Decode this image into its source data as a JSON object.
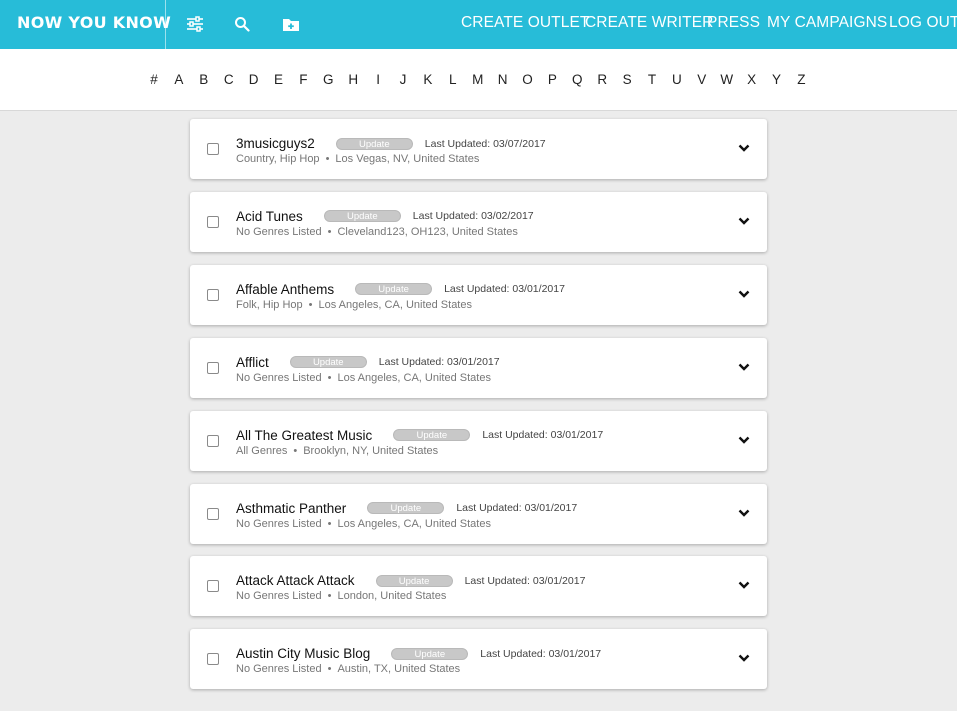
{
  "header": {
    "brand": "NOW YOU KNOW",
    "icons": [
      "sliders-icon",
      "search-icon",
      "folder-plus-icon"
    ],
    "nav": [
      "CREATE OUTLET",
      "CREATE WRITER",
      "PRESS",
      "MY CAMPAIGNS",
      "LOG OUT"
    ],
    "accent_color": "#27bcd8"
  },
  "alphabet": [
    "#",
    "A",
    "B",
    "C",
    "D",
    "E",
    "F",
    "G",
    "H",
    "I",
    "J",
    "K",
    "L",
    "M",
    "N",
    "O",
    "P",
    "Q",
    "R",
    "S",
    "T",
    "U",
    "V",
    "W",
    "X",
    "Y",
    "Z"
  ],
  "outlets": [
    {
      "name": "3musicguys2",
      "badge": "Update",
      "updated": "Last Updated: 03/07/2017",
      "genres": "Country, Hip Hop",
      "location": "Los Vegas, NV, United States"
    },
    {
      "name": "Acid Tunes",
      "badge": "Update",
      "updated": "Last Updated: 03/02/2017",
      "genres": "No Genres Listed",
      "location": "Cleveland123, OH123, United States"
    },
    {
      "name": "Affable Anthems",
      "badge": "Update",
      "updated": "Last Updated: 03/01/2017",
      "genres": "Folk, Hip Hop",
      "location": "Los Angeles, CA, United States"
    },
    {
      "name": "Afflict",
      "badge": "Update",
      "updated": "Last Updated: 03/01/2017",
      "genres": "No Genres Listed",
      "location": "Los Angeles, CA, United States"
    },
    {
      "name": "All The Greatest Music",
      "badge": "Update",
      "updated": "Last Updated: 03/01/2017",
      "genres": "All Genres",
      "location": "Brooklyn, NY, United States"
    },
    {
      "name": "Asthmatic Panther",
      "badge": "Update",
      "updated": "Last Updated: 03/01/2017",
      "genres": "No Genres Listed",
      "location": "Los Angeles, CA, United States"
    },
    {
      "name": "Attack Attack Attack",
      "badge": "Update",
      "updated": "Last Updated: 03/01/2017",
      "genres": "No Genres Listed",
      "location": "London, United States"
    },
    {
      "name": "Austin City Music Blog",
      "badge": "Update",
      "updated": "Last Updated: 03/01/2017",
      "genres": "No Genres Listed",
      "location": "Austin, TX, United States"
    }
  ]
}
